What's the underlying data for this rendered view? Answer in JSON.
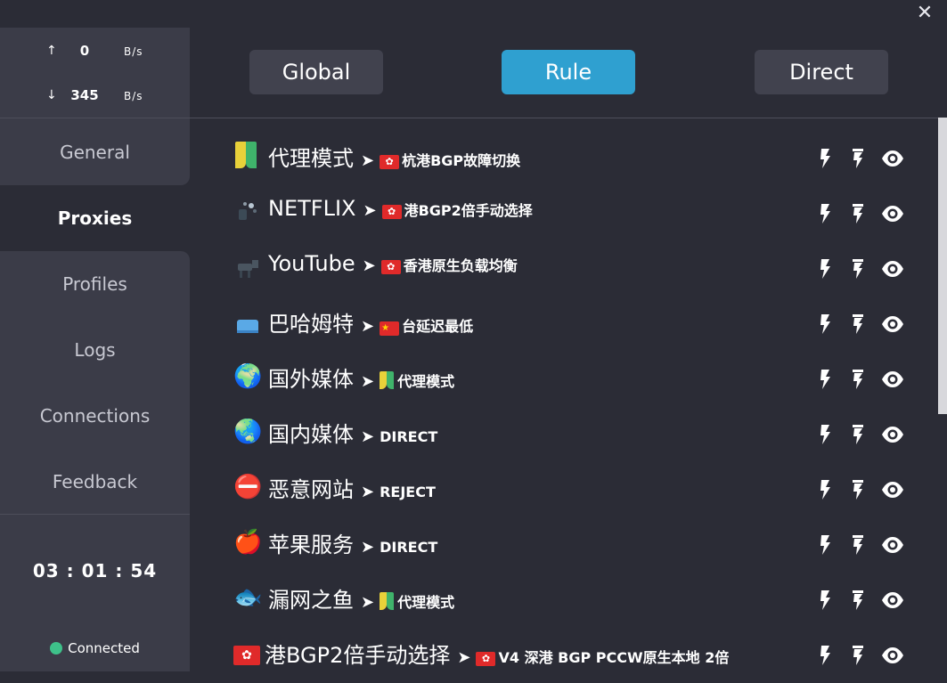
{
  "window": {
    "close_glyph": "✕"
  },
  "speed": {
    "up_arrow": "↑",
    "up_value": "0",
    "up_unit": "B/s",
    "down_arrow": "↓",
    "down_value": "345",
    "down_unit": "B/s"
  },
  "nav": {
    "items": [
      {
        "label": "General"
      },
      {
        "label": "Proxies"
      },
      {
        "label": "Profiles"
      },
      {
        "label": "Logs"
      },
      {
        "label": "Connections"
      },
      {
        "label": "Feedback"
      }
    ],
    "active": "Proxies"
  },
  "timer": "03 : 01 : 54",
  "status": {
    "label": "Connected",
    "color": "#3ec18a"
  },
  "modes": {
    "global": "Global",
    "rule": "Rule",
    "direct": "Direct",
    "active": "Rule",
    "accent": "#2fa0d0"
  },
  "separator": "➤",
  "groups": [
    {
      "icon": "beginner-icon",
      "emoji": "",
      "name": "代理模式",
      "sel_flag": "hk",
      "selected": "杭港BGP故障切换"
    },
    {
      "icon": "netflix-icon",
      "emoji": "",
      "name": "NETFLIX",
      "sel_flag": "hk",
      "selected": "港BGP2倍手动选择"
    },
    {
      "icon": "youtube-icon",
      "emoji": "",
      "name": "YouTube",
      "sel_flag": "hk",
      "selected": "香港原生负载均衡"
    },
    {
      "icon": "tv-icon",
      "emoji": "",
      "name": "巴哈姆特",
      "sel_flag": "cn",
      "selected": "台延迟最低"
    },
    {
      "icon": "globe-icon",
      "emoji": "🌍",
      "name": "国外媒体",
      "sel_flag": "beginner",
      "selected": "代理模式"
    },
    {
      "icon": "globe-icon",
      "emoji": "🌏",
      "name": "国内媒体",
      "sel_flag": "",
      "selected": "DIRECT"
    },
    {
      "icon": "no-entry-icon",
      "emoji": "⛔",
      "name": "恶意网站",
      "sel_flag": "",
      "selected": "REJECT"
    },
    {
      "icon": "apple-icon",
      "emoji": "🍎",
      "name": "苹果服务",
      "sel_flag": "",
      "selected": "DIRECT"
    },
    {
      "icon": "fish-icon",
      "emoji": "🐟",
      "name": "漏网之鱼",
      "sel_flag": "beginner",
      "selected": "代理模式"
    },
    {
      "icon": "hk-flag-icon",
      "emoji": "",
      "name": "港BGP2倍手动选择",
      "sel_flag": "hk",
      "selected": "V4 深港 BGP PCCW原生本地 2倍"
    }
  ]
}
